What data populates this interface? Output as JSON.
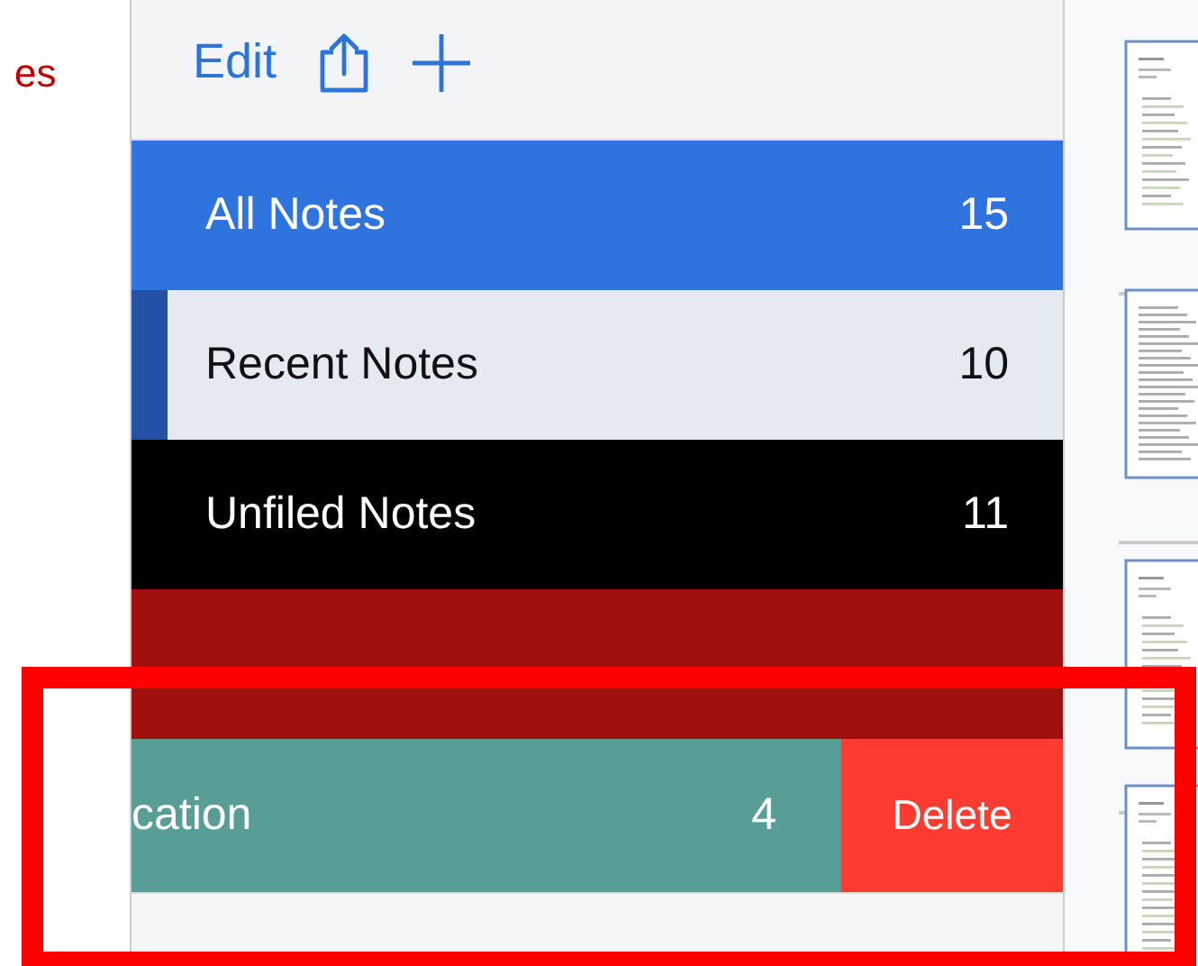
{
  "side_text": "es",
  "toolbar": {
    "edit": "Edit"
  },
  "notebooks": [
    {
      "kind": "row",
      "name": "All Notes",
      "count": "15",
      "color": "#2f74de",
      "selected": false
    },
    {
      "kind": "row",
      "name": "Recent Notes",
      "count": "10",
      "color": "#e5e9f0",
      "selected": true
    },
    {
      "kind": "row",
      "name": "Unfiled Notes",
      "count": "11",
      "color": "#000000",
      "selected": false
    },
    {
      "kind": "covered",
      "color": "#a0100c",
      "selected": false
    },
    {
      "kind": "swiped",
      "name": "cation",
      "count": "4",
      "color": "#589e96",
      "selected": false,
      "action": "Delete"
    }
  ],
  "thumbnails": [
    {
      "kind": "list"
    },
    {
      "kind": "text"
    },
    {
      "kind": "list"
    },
    {
      "kind": "list"
    }
  ],
  "annotation": {
    "kind": "frame"
  }
}
